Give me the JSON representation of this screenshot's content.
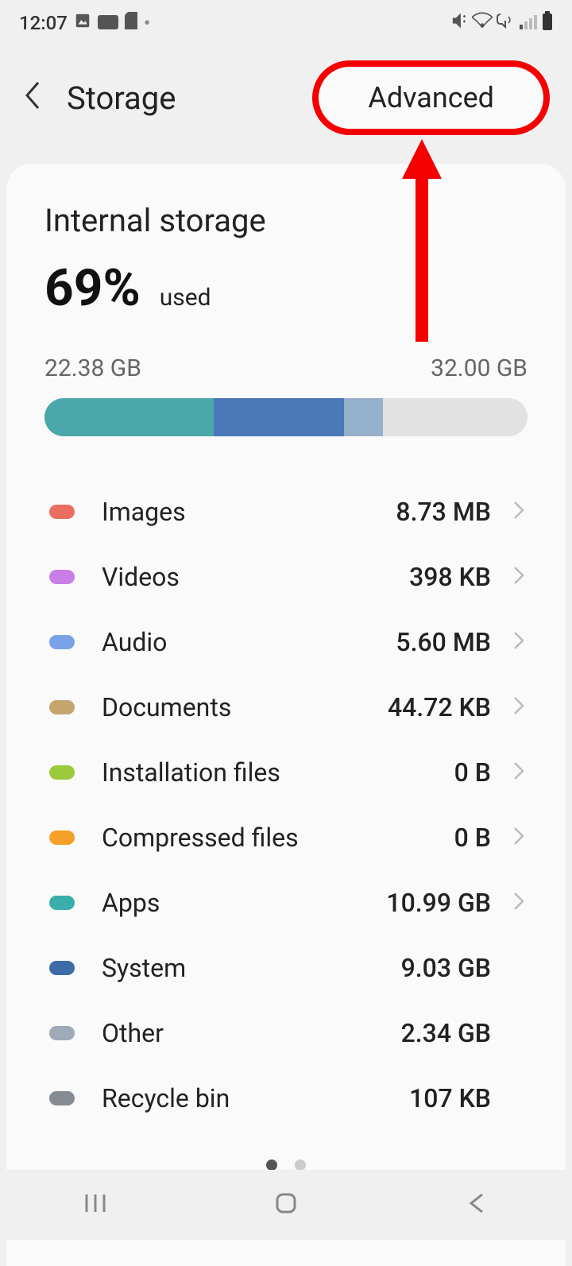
{
  "status": {
    "time": "12:07"
  },
  "header": {
    "title": "Storage",
    "advanced": "Advanced"
  },
  "storage": {
    "title": "Internal storage",
    "percent": "69%",
    "used_label": "used",
    "used_size": "22.38 GB",
    "total_size": "32.00 GB"
  },
  "categories": [
    {
      "label": "Images",
      "value": "8.73 MB",
      "color": "#e96e60",
      "clickable": true
    },
    {
      "label": "Videos",
      "value": "398 KB",
      "color": "#c97de6",
      "clickable": true
    },
    {
      "label": "Audio",
      "value": "5.60 MB",
      "color": "#7aa2e8",
      "clickable": true
    },
    {
      "label": "Documents",
      "value": "44.72 KB",
      "color": "#c4a56e",
      "clickable": true
    },
    {
      "label": "Installation files",
      "value": "0 B",
      "color": "#9bcb3d",
      "clickable": true
    },
    {
      "label": "Compressed files",
      "value": "0 B",
      "color": "#f5a028",
      "clickable": true
    },
    {
      "label": "Apps",
      "value": "10.99 GB",
      "color": "#3aafa9",
      "clickable": true
    },
    {
      "label": "System",
      "value": "9.03 GB",
      "color": "#3c6ba8",
      "clickable": false
    },
    {
      "label": "Other",
      "value": "2.34 GB",
      "color": "#9eaab8",
      "clickable": false
    },
    {
      "label": "Recycle bin",
      "value": "107 KB",
      "color": "#868a92",
      "clickable": false
    }
  ]
}
